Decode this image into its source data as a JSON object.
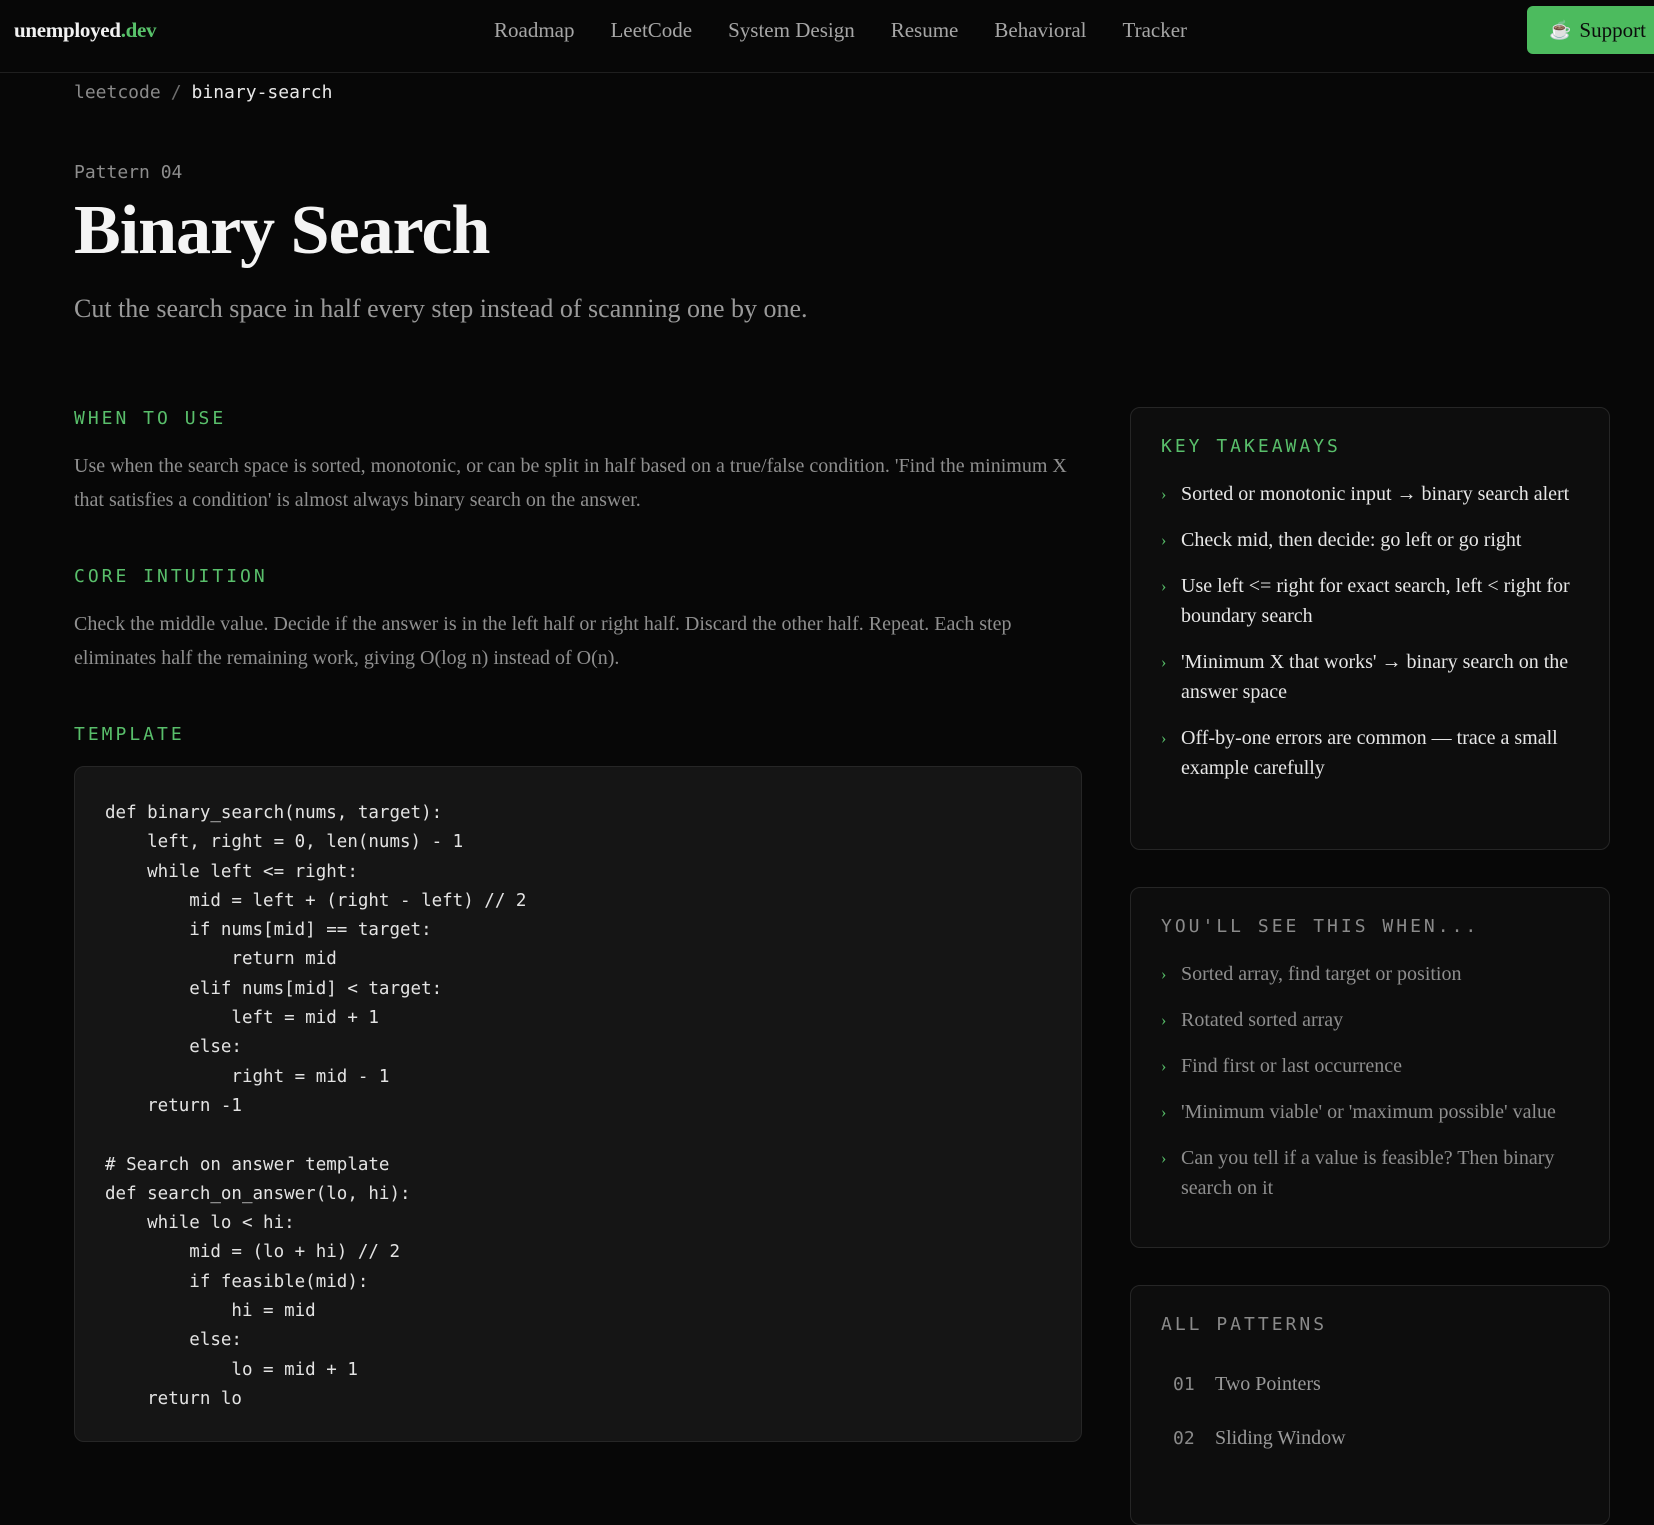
{
  "brand": {
    "name": "unemployed",
    "tld": ".dev"
  },
  "nav": {
    "links": [
      "Roadmap",
      "LeetCode",
      "System Design",
      "Resume",
      "Behavioral",
      "Tracker"
    ],
    "support_label": "Support",
    "support_icon": "coffee-cup-icon"
  },
  "breadcrumb": {
    "parent": "leetcode",
    "separator": "/",
    "current": "binary-search"
  },
  "hero": {
    "eyebrow": "Pattern 04",
    "title": "Binary Search",
    "subtitle": "Cut the search space in half every step instead of scanning one by one."
  },
  "sections": {
    "when_to_use": {
      "label": "WHEN TO USE",
      "text": "Use when the search space is sorted, monotonic, or can be split in half based on a true/false condition. 'Find the minimum X that satisfies a condition' is almost always binary search on the answer."
    },
    "core_intuition": {
      "label": "CORE INTUITION",
      "text": "Check the middle value. Decide if the answer is in the left half or right half. Discard the other half. Repeat. Each step eliminates half the remaining work, giving O(log n) instead of O(n)."
    },
    "template": {
      "label": "TEMPLATE",
      "code": "def binary_search(nums, target):\n    left, right = 0, len(nums) - 1\n    while left <= right:\n        mid = left + (right - left) // 2\n        if nums[mid] == target:\n            return mid\n        elif nums[mid] < target:\n            left = mid + 1\n        else:\n            right = mid - 1\n    return -1\n\n# Search on answer template\ndef search_on_answer(lo, hi):\n    while lo < hi:\n        mid = (lo + hi) // 2\n        if feasible(mid):\n            hi = mid\n        else:\n            lo = mid + 1\n    return lo"
    }
  },
  "takeaways": {
    "title": "KEY TAKEAWAYS",
    "items": [
      "Sorted or monotonic input → binary search alert",
      "Check mid, then decide: go left or go right",
      "Use left <= right for exact search, left < right for boundary search",
      "'Minimum X that works' → binary search on the answer space",
      "Off-by-one errors are common — trace a small example carefully"
    ]
  },
  "see_when": {
    "title": "YOU'LL SEE THIS WHEN...",
    "items": [
      "Sorted array, find target or position",
      "Rotated sorted array",
      "Find first or last occurrence",
      "'Minimum viable' or 'maximum possible' value",
      "Can you tell if a value is feasible? Then binary search on it"
    ]
  },
  "all_patterns": {
    "title": "ALL PATTERNS",
    "items": [
      {
        "num": "01",
        "name": "Two Pointers"
      },
      {
        "num": "02",
        "name": "Sliding Window"
      }
    ]
  },
  "colors": {
    "accent": "#58c16a",
    "background": "#070707",
    "card": "#0d0d0d",
    "code_bg": "#151515"
  }
}
